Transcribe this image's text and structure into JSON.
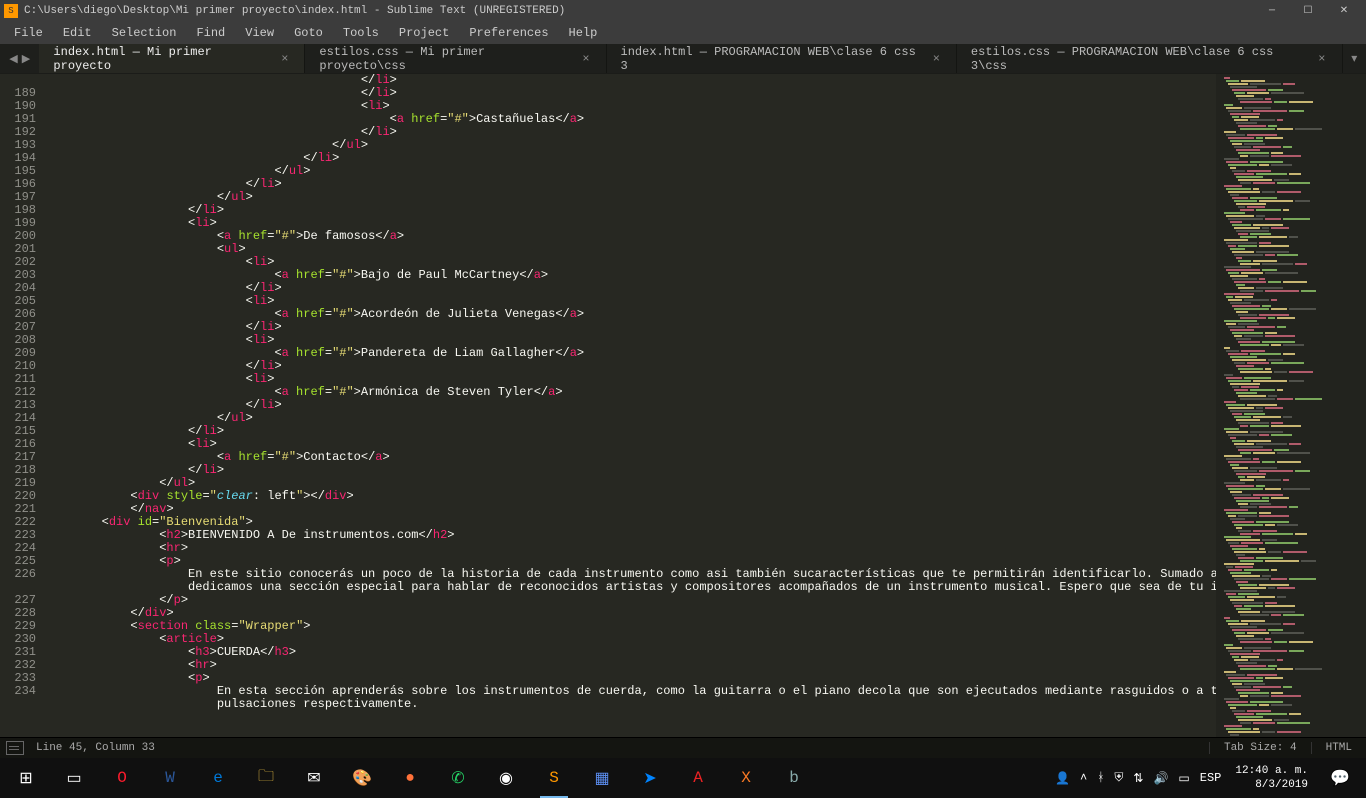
{
  "titlebar": {
    "title": "C:\\Users\\diego\\Desktop\\Mi primer proyecto\\index.html - Sublime Text (UNREGISTERED)"
  },
  "menu": [
    "File",
    "Edit",
    "Selection",
    "Find",
    "View",
    "Goto",
    "Tools",
    "Project",
    "Preferences",
    "Help"
  ],
  "tabs": [
    {
      "label": "index.html — Mi primer proyecto",
      "active": true
    },
    {
      "label": "estilos.css — Mi primer proyecto\\css",
      "active": false
    },
    {
      "label": "index.html — PROGRAMACION  WEB\\clase 6 css 3",
      "active": false
    },
    {
      "label": "estilos.css — PROGRAMACION  WEB\\clase 6 css 3\\css",
      "active": false
    }
  ],
  "gutter_start": 189,
  "lines": [
    {
      "n": null,
      "indent": 44,
      "segs": [
        [
          "punc",
          "</"
        ],
        [
          "tag",
          "li"
        ],
        [
          "punc",
          ">"
        ]
      ]
    },
    {
      "n": 189,
      "indent": 44,
      "segs": [
        [
          "punc",
          "</"
        ],
        [
          "tag",
          "li"
        ],
        [
          "punc",
          ">"
        ]
      ]
    },
    {
      "n": 190,
      "indent": 44,
      "segs": [
        [
          "punc",
          "<"
        ],
        [
          "tag",
          "li"
        ],
        [
          "punc",
          ">"
        ]
      ]
    },
    {
      "n": 191,
      "indent": 48,
      "segs": [
        [
          "punc",
          "<"
        ],
        [
          "tag",
          "a"
        ],
        [
          "punc",
          " "
        ],
        [
          "attr",
          "href"
        ],
        [
          "punc",
          "="
        ],
        [
          "str",
          "\"#\""
        ],
        [
          "punc",
          ">"
        ],
        [
          "txt",
          "Castañuelas"
        ],
        [
          "punc",
          "</"
        ],
        [
          "tag",
          "a"
        ],
        [
          "punc",
          ">"
        ]
      ]
    },
    {
      "n": 192,
      "indent": 44,
      "segs": [
        [
          "punc",
          "</"
        ],
        [
          "tag",
          "li"
        ],
        [
          "punc",
          ">"
        ]
      ]
    },
    {
      "n": 193,
      "indent": 40,
      "segs": [
        [
          "punc",
          "</"
        ],
        [
          "tag",
          "ul"
        ],
        [
          "punc",
          ">"
        ]
      ]
    },
    {
      "n": 194,
      "indent": 36,
      "segs": [
        [
          "punc",
          "</"
        ],
        [
          "tag",
          "li"
        ],
        [
          "punc",
          ">"
        ]
      ]
    },
    {
      "n": 195,
      "indent": 32,
      "segs": [
        [
          "punc",
          "</"
        ],
        [
          "tag",
          "ul"
        ],
        [
          "punc",
          ">"
        ]
      ]
    },
    {
      "n": 196,
      "indent": 28,
      "segs": [
        [
          "punc",
          "</"
        ],
        [
          "tag",
          "li"
        ],
        [
          "punc",
          ">"
        ]
      ]
    },
    {
      "n": 197,
      "indent": 24,
      "segs": [
        [
          "punc",
          "</"
        ],
        [
          "tag",
          "ul"
        ],
        [
          "punc",
          ">"
        ]
      ]
    },
    {
      "n": 198,
      "indent": 20,
      "segs": [
        [
          "punc",
          "</"
        ],
        [
          "tag",
          "li"
        ],
        [
          "punc",
          ">"
        ]
      ]
    },
    {
      "n": 199,
      "indent": 20,
      "segs": [
        [
          "punc",
          "<"
        ],
        [
          "tag",
          "li"
        ],
        [
          "punc",
          ">"
        ]
      ]
    },
    {
      "n": 200,
      "indent": 24,
      "segs": [
        [
          "punc",
          "<"
        ],
        [
          "tag",
          "a"
        ],
        [
          "punc",
          " "
        ],
        [
          "attr",
          "href"
        ],
        [
          "punc",
          "="
        ],
        [
          "str",
          "\"#\""
        ],
        [
          "punc",
          ">"
        ],
        [
          "txt",
          "De famosos"
        ],
        [
          "punc",
          "</"
        ],
        [
          "tag",
          "a"
        ],
        [
          "punc",
          ">"
        ]
      ]
    },
    {
      "n": 201,
      "indent": 24,
      "segs": [
        [
          "punc",
          "<"
        ],
        [
          "tag",
          "ul"
        ],
        [
          "punc",
          ">"
        ]
      ]
    },
    {
      "n": 202,
      "indent": 28,
      "segs": [
        [
          "punc",
          "<"
        ],
        [
          "tag",
          "li"
        ],
        [
          "punc",
          ">"
        ]
      ]
    },
    {
      "n": 203,
      "indent": 32,
      "segs": [
        [
          "punc",
          "<"
        ],
        [
          "tag",
          "a"
        ],
        [
          "punc",
          " "
        ],
        [
          "attr",
          "href"
        ],
        [
          "punc",
          "="
        ],
        [
          "str",
          "\"#\""
        ],
        [
          "punc",
          ">"
        ],
        [
          "txt",
          "Bajo de Paul McCartney"
        ],
        [
          "punc",
          "</"
        ],
        [
          "tag",
          "a"
        ],
        [
          "punc",
          ">"
        ]
      ]
    },
    {
      "n": 204,
      "indent": 28,
      "segs": [
        [
          "punc",
          "</"
        ],
        [
          "tag",
          "li"
        ],
        [
          "punc",
          ">"
        ]
      ]
    },
    {
      "n": 205,
      "indent": 28,
      "segs": [
        [
          "punc",
          "<"
        ],
        [
          "tag",
          "li"
        ],
        [
          "punc",
          ">"
        ]
      ]
    },
    {
      "n": 206,
      "indent": 32,
      "segs": [
        [
          "punc",
          "<"
        ],
        [
          "tag",
          "a"
        ],
        [
          "punc",
          " "
        ],
        [
          "attr",
          "href"
        ],
        [
          "punc",
          "="
        ],
        [
          "str",
          "\"#\""
        ],
        [
          "punc",
          ">"
        ],
        [
          "txt",
          "Acordeón de Julieta Venegas"
        ],
        [
          "punc",
          "</"
        ],
        [
          "tag",
          "a"
        ],
        [
          "punc",
          ">"
        ]
      ]
    },
    {
      "n": 207,
      "indent": 28,
      "segs": [
        [
          "punc",
          "</"
        ],
        [
          "tag",
          "li"
        ],
        [
          "punc",
          ">"
        ]
      ]
    },
    {
      "n": 208,
      "indent": 28,
      "segs": [
        [
          "punc",
          "<"
        ],
        [
          "tag",
          "li"
        ],
        [
          "punc",
          ">"
        ]
      ]
    },
    {
      "n": 209,
      "indent": 32,
      "segs": [
        [
          "punc",
          "<"
        ],
        [
          "tag",
          "a"
        ],
        [
          "punc",
          " "
        ],
        [
          "attr",
          "href"
        ],
        [
          "punc",
          "="
        ],
        [
          "str",
          "\"#\""
        ],
        [
          "punc",
          ">"
        ],
        [
          "txt",
          "Pandereta de Liam Gallagher"
        ],
        [
          "punc",
          "</"
        ],
        [
          "tag",
          "a"
        ],
        [
          "punc",
          ">"
        ]
      ]
    },
    {
      "n": 210,
      "indent": 28,
      "segs": [
        [
          "punc",
          "</"
        ],
        [
          "tag",
          "li"
        ],
        [
          "punc",
          ">"
        ]
      ]
    },
    {
      "n": 211,
      "indent": 28,
      "segs": [
        [
          "punc",
          "<"
        ],
        [
          "tag",
          "li"
        ],
        [
          "punc",
          ">"
        ]
      ]
    },
    {
      "n": 212,
      "indent": 32,
      "segs": [
        [
          "punc",
          "<"
        ],
        [
          "tag",
          "a"
        ],
        [
          "punc",
          " "
        ],
        [
          "attr",
          "href"
        ],
        [
          "punc",
          "="
        ],
        [
          "str",
          "\"#\""
        ],
        [
          "punc",
          ">"
        ],
        [
          "txt",
          "Armónica de Steven Tyler"
        ],
        [
          "punc",
          "</"
        ],
        [
          "tag",
          "a"
        ],
        [
          "punc",
          ">"
        ]
      ]
    },
    {
      "n": 213,
      "indent": 28,
      "segs": [
        [
          "punc",
          "</"
        ],
        [
          "tag",
          "li"
        ],
        [
          "punc",
          ">"
        ]
      ]
    },
    {
      "n": 214,
      "indent": 24,
      "segs": [
        [
          "punc",
          "</"
        ],
        [
          "tag",
          "ul"
        ],
        [
          "punc",
          ">"
        ]
      ]
    },
    {
      "n": 215,
      "indent": 20,
      "segs": [
        [
          "punc",
          "</"
        ],
        [
          "tag",
          "li"
        ],
        [
          "punc",
          ">"
        ]
      ]
    },
    {
      "n": 216,
      "indent": 20,
      "segs": [
        [
          "punc",
          "<"
        ],
        [
          "tag",
          "li"
        ],
        [
          "punc",
          ">"
        ]
      ]
    },
    {
      "n": 217,
      "indent": 24,
      "segs": [
        [
          "punc",
          "<"
        ],
        [
          "tag",
          "a"
        ],
        [
          "punc",
          " "
        ],
        [
          "attr",
          "href"
        ],
        [
          "punc",
          "="
        ],
        [
          "str",
          "\"#\""
        ],
        [
          "punc",
          ">"
        ],
        [
          "txt",
          "Contacto"
        ],
        [
          "punc",
          "</"
        ],
        [
          "tag",
          "a"
        ],
        [
          "punc",
          ">"
        ]
      ]
    },
    {
      "n": 218,
      "indent": 20,
      "segs": [
        [
          "punc",
          "</"
        ],
        [
          "tag",
          "li"
        ],
        [
          "punc",
          ">"
        ]
      ]
    },
    {
      "n": 219,
      "indent": 16,
      "segs": [
        [
          "punc",
          "</"
        ],
        [
          "tag",
          "ul"
        ],
        [
          "punc",
          ">"
        ]
      ]
    },
    {
      "n": 220,
      "indent": 12,
      "segs": [
        [
          "punc",
          "<"
        ],
        [
          "tag",
          "div"
        ],
        [
          "punc",
          " "
        ],
        [
          "attr",
          "style"
        ],
        [
          "punc",
          "="
        ],
        [
          "str",
          "\""
        ],
        [
          "prop",
          "clear"
        ],
        [
          "punc",
          ": "
        ],
        [
          "txt",
          "left"
        ],
        [
          "str",
          "\""
        ],
        [
          "punc",
          "></"
        ],
        [
          "tag",
          "div"
        ],
        [
          "punc",
          ">"
        ]
      ]
    },
    {
      "n": 221,
      "indent": 12,
      "segs": [
        [
          "punc",
          "</"
        ],
        [
          "tag",
          "nav"
        ],
        [
          "punc",
          ">"
        ]
      ]
    },
    {
      "n": 222,
      "indent": 8,
      "segs": [
        [
          "punc",
          "<"
        ],
        [
          "tag",
          "div"
        ],
        [
          "punc",
          " "
        ],
        [
          "attr",
          "id"
        ],
        [
          "punc",
          "="
        ],
        [
          "str",
          "\"Bienvenida\""
        ],
        [
          "punc",
          ">"
        ]
      ]
    },
    {
      "n": 223,
      "indent": 16,
      "segs": [
        [
          "punc",
          "<"
        ],
        [
          "tag",
          "h2"
        ],
        [
          "punc",
          ">"
        ],
        [
          "txt",
          "BIENVENIDO A De instrumentos.com"
        ],
        [
          "punc",
          "</"
        ],
        [
          "tag",
          "h2"
        ],
        [
          "punc",
          ">"
        ]
      ]
    },
    {
      "n": 224,
      "indent": 16,
      "segs": [
        [
          "punc",
          "<"
        ],
        [
          "tag",
          "hr"
        ],
        [
          "punc",
          ">"
        ]
      ]
    },
    {
      "n": 225,
      "indent": 16,
      "segs": [
        [
          "punc",
          "<"
        ],
        [
          "tag",
          "p"
        ],
        [
          "punc",
          ">"
        ]
      ]
    },
    {
      "n": 226,
      "indent": 20,
      "segs": [
        [
          "txt",
          "En este sitio conocerás un poco de la historia de cada instrumento como asi también sucaracterísticas que te permitirán identificarlo. Sumado a esto, le dedicamos una sección especial para hablar de reconocidos artistas y compositores acompañados de un instrumento musical. Espero que sea de tu interés."
        ]
      ]
    },
    {
      "n": 227,
      "indent": 16,
      "segs": [
        [
          "punc",
          "</"
        ],
        [
          "tag",
          "p"
        ],
        [
          "punc",
          ">"
        ]
      ]
    },
    {
      "n": 228,
      "indent": 12,
      "segs": [
        [
          "punc",
          "</"
        ],
        [
          "tag",
          "div"
        ],
        [
          "punc",
          ">"
        ]
      ]
    },
    {
      "n": 229,
      "indent": 12,
      "segs": [
        [
          "punc",
          "<"
        ],
        [
          "tag",
          "section"
        ],
        [
          "punc",
          " "
        ],
        [
          "attr",
          "class"
        ],
        [
          "punc",
          "="
        ],
        [
          "str",
          "\"Wrapper\""
        ],
        [
          "punc",
          ">"
        ]
      ]
    },
    {
      "n": 230,
      "indent": 16,
      "segs": [
        [
          "punc",
          "<"
        ],
        [
          "tag",
          "article"
        ],
        [
          "punc",
          ">"
        ]
      ]
    },
    {
      "n": 231,
      "indent": 20,
      "segs": [
        [
          "punc",
          "<"
        ],
        [
          "tag",
          "h3"
        ],
        [
          "punc",
          ">"
        ],
        [
          "txt",
          "CUERDA"
        ],
        [
          "punc",
          "</"
        ],
        [
          "tag",
          "h3"
        ],
        [
          "punc",
          ">"
        ]
      ]
    },
    {
      "n": 232,
      "indent": 20,
      "segs": [
        [
          "punc",
          "<"
        ],
        [
          "tag",
          "hr"
        ],
        [
          "punc",
          ">"
        ]
      ]
    },
    {
      "n": 233,
      "indent": 20,
      "segs": [
        [
          "punc",
          "<"
        ],
        [
          "tag",
          "p"
        ],
        [
          "punc",
          ">"
        ]
      ]
    },
    {
      "n": 234,
      "indent": 24,
      "segs": [
        [
          "txt",
          "En esta sección aprenderás sobre los instrumentos de cuerda, como la guitarra o el piano decola que son ejecutados mediante rasguidos o a través de pulsaciones respectivamente."
        ]
      ]
    }
  ],
  "status": {
    "selection": "Line 45, Column 33",
    "tabsize": "Tab Size: 4",
    "syntax": "HTML"
  },
  "tray": {
    "lang": "ESP",
    "time": "12:40 a. m.",
    "date": "8/3/2019"
  },
  "taskbar_icons": [
    {
      "name": "start-icon",
      "glyph": "⊞",
      "color": "#fff"
    },
    {
      "name": "taskview-icon",
      "glyph": "▭",
      "color": "#fff"
    },
    {
      "name": "opera-icon",
      "glyph": "O",
      "color": "#ff1b2d"
    },
    {
      "name": "word-icon",
      "glyph": "W",
      "color": "#2b579a"
    },
    {
      "name": "edge-icon",
      "glyph": "e",
      "color": "#0078d7"
    },
    {
      "name": "explorer-icon",
      "glyph": "🗀",
      "color": "#ffcf48"
    },
    {
      "name": "mail-icon",
      "glyph": "✉",
      "color": "#fff"
    },
    {
      "name": "paint-icon",
      "glyph": "🎨",
      "color": "#fff"
    },
    {
      "name": "firefox-icon",
      "glyph": "●",
      "color": "#ff7139"
    },
    {
      "name": "whatsapp-icon",
      "glyph": "✆",
      "color": "#25d366"
    },
    {
      "name": "chrome-icon",
      "glyph": "◉",
      "color": "#fff"
    },
    {
      "name": "sublime-icon",
      "glyph": "S",
      "color": "#ff9800",
      "active": true
    },
    {
      "name": "app-icon-1",
      "glyph": "▦",
      "color": "#5b8def"
    },
    {
      "name": "messenger-icon",
      "glyph": "➤",
      "color": "#0084ff"
    },
    {
      "name": "acrobat-icon",
      "glyph": "A",
      "color": "#ed2224"
    },
    {
      "name": "xampp-icon",
      "glyph": "X",
      "color": "#fb7a24"
    },
    {
      "name": "app-icon-2",
      "glyph": "b",
      "color": "#8aa"
    }
  ]
}
